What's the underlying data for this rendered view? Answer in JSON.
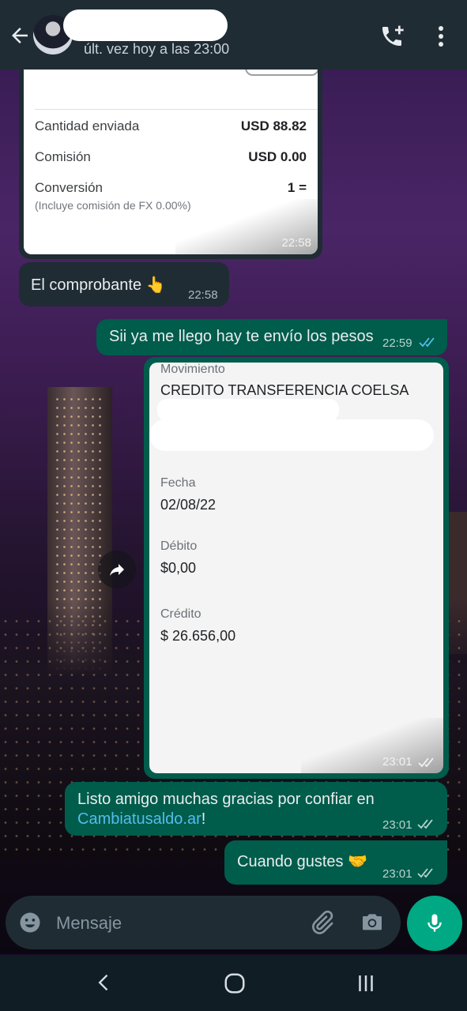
{
  "header": {
    "last_seen": "últ. vez hoy a las 23:00"
  },
  "messages": {
    "receipt1": {
      "rows": [
        {
          "label": "Cantidad enviada",
          "value": "USD 88.82"
        },
        {
          "label": "Comisión",
          "value": "USD 0.00"
        },
        {
          "label": "Conversión",
          "value": "1 ="
        }
      ],
      "conversion_note": "(Incluye comisión de FX 0.00%)",
      "time": "22:58"
    },
    "comprobante": {
      "text": "El comprobante 👆",
      "time": "22:58"
    },
    "reply1": {
      "text": "Sii ya me llego hay te envío los pesos",
      "time": "22:59"
    },
    "receipt2": {
      "movimiento_label": "Movimiento",
      "movimiento_value": "CREDITO TRANSFERENCIA COELSA",
      "fecha_label": "Fecha",
      "fecha_value": "02/08/22",
      "debito_label": "Débito",
      "debito_value": "$0,00",
      "credito_label": "Crédito",
      "credito_value": "$ 26.656,00",
      "time": "23:01"
    },
    "thanks": {
      "text_before": "Listo amigo muchas gracias por confiar en ",
      "link": "Cambiatusaldo.ar",
      "text_after": "!",
      "time": "23:01"
    },
    "gustes": {
      "text": "Cuando gustes 🤝",
      "time": "23:01"
    }
  },
  "input": {
    "placeholder": "Mensaje"
  },
  "icons": [
    "back-arrow-icon",
    "add-call-icon",
    "more-vert-icon",
    "forward-icon",
    "emoji-icon",
    "attach-icon",
    "camera-icon",
    "mic-icon",
    "nav-back-icon",
    "nav-home-icon",
    "nav-recents-icon"
  ],
  "colors": {
    "header": "#1f2c34",
    "outgoing": "#005c4b",
    "incoming": "#1f2c34",
    "accent": "#00a884",
    "link": "#53bdeb",
    "read_ticks": "#53bdeb"
  }
}
